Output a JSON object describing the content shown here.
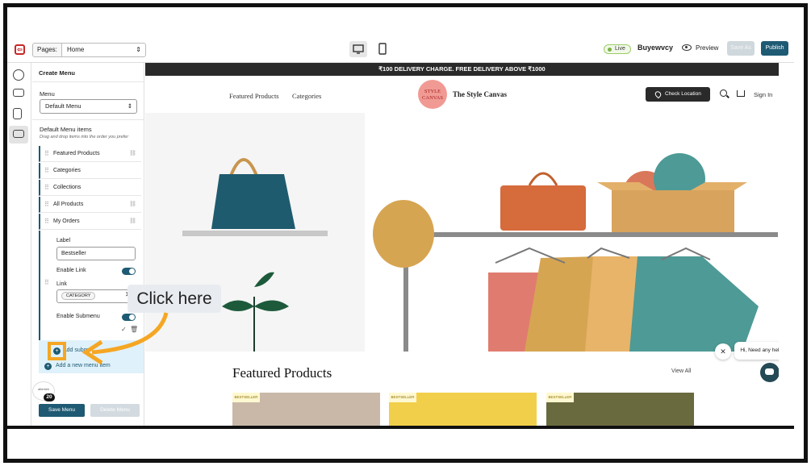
{
  "toolbar": {
    "pages_label": "Pages:",
    "page_selected": "Home",
    "live_badge": "Live",
    "store_name": "Buyewvcy",
    "preview_label": "Preview",
    "save_as_label": "Save As",
    "publish_label": "Publish"
  },
  "panel": {
    "title": "Create Menu",
    "menu_label": "Menu",
    "menu_selected": "Default Menu",
    "items_title": "Default Menu items",
    "items_hint": "Drag and drop items into the order you prefer",
    "items": [
      {
        "label": "Featured Products",
        "has_link_icon": true
      },
      {
        "label": "Categories",
        "has_link_icon": false
      },
      {
        "label": "Collections",
        "has_link_icon": false
      },
      {
        "label": "All Products",
        "has_link_icon": true
      },
      {
        "label": "My Orders",
        "has_link_icon": true
      }
    ],
    "editor": {
      "label_field_label": "Label",
      "label_field_value": "Bestseller",
      "enable_link_label": "Enable Link",
      "enable_link_on": true,
      "link_label": "Link",
      "link_chip": "CATEGORY",
      "enable_submenu_label": "Enable Submenu",
      "enable_submenu_on": true
    },
    "add_submenu_label": "Add subm",
    "add_new_label": "Add a new menu item",
    "save_label": "Save Menu",
    "delete_label": "Delete Menu",
    "badge_count": "20",
    "tip_label": "allentek"
  },
  "store": {
    "promo": "₹100 DELIVERY CHARGE. FREE DELIVERY ABOVE ₹1000",
    "nav_links": [
      "Featured Products",
      "Categories"
    ],
    "logo_text": "STYLE CANVAS",
    "brand": "The Style Canvas",
    "check_location": "Check Location",
    "sign_in": "Sign In",
    "featured_title": "Featured Products",
    "view_all": "View All",
    "product_badge": "BESTSELLER",
    "chat_greeting": "Hi, Need any help?"
  },
  "annotation": {
    "callout": "Click here"
  },
  "colors": {
    "brand_teal": "#1e5a73",
    "highlight": "#f5a623",
    "promo_bar": "#2a2a2a"
  },
  "icons": [
    "app-logo-icon",
    "chevron-updown-icon",
    "desktop-icon",
    "mobile-icon",
    "eye-icon",
    "palette-icon",
    "layout-icon",
    "pages-icon",
    "menu-icon",
    "help-icon",
    "drag-handle-icon",
    "link-icon",
    "check-icon",
    "trash-icon",
    "plus-circle-icon",
    "location-pin-icon",
    "search-icon",
    "cart-icon",
    "chat-icon",
    "close-icon"
  ]
}
